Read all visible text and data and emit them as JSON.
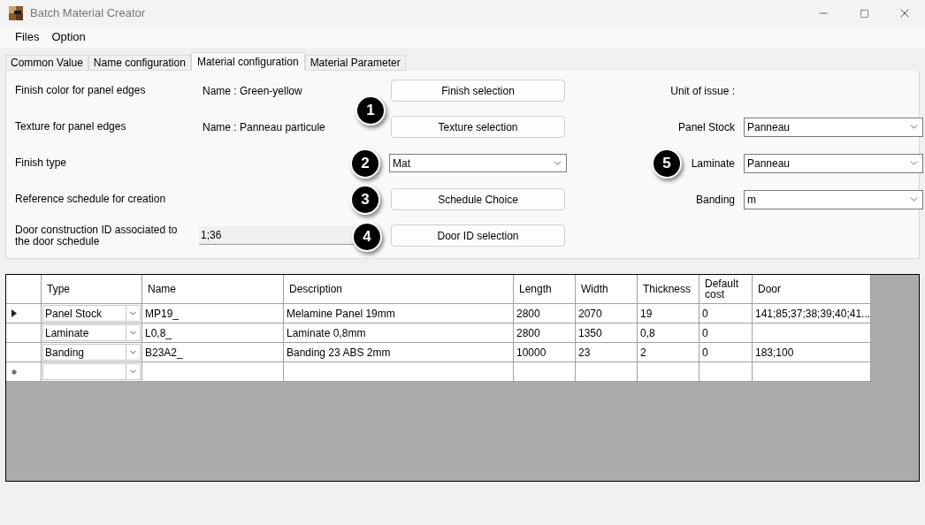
{
  "window": {
    "title": "Batch Material Creator"
  },
  "menu": [
    "Files",
    "Option"
  ],
  "tabs": [
    {
      "label": "Common Value",
      "selected": false
    },
    {
      "label": "Name configuration",
      "selected": false
    },
    {
      "label": "Material configuration",
      "selected": true
    },
    {
      "label": "Material Parameter",
      "selected": false
    }
  ],
  "form_rows": [
    {
      "label": "Finish color for panel edges",
      "info": {
        "kind": "text",
        "value": "Name : Green-yellow"
      },
      "control": {
        "kind": "button",
        "label": "Finish selection"
      }
    },
    {
      "label": "Texture for panel edges",
      "info": {
        "kind": "text",
        "value": "Name : Panneau particule"
      },
      "control": {
        "kind": "button",
        "label": "Texture selection"
      }
    },
    {
      "label": "Finish type",
      "control": {
        "kind": "combo",
        "value": "Mat"
      }
    },
    {
      "label": "Reference schedule for creation",
      "control": {
        "kind": "button",
        "label": "Schedule Choice"
      }
    },
    {
      "label": "Door construction ID associated to the door schedule",
      "info": {
        "kind": "field",
        "value": "1;36"
      },
      "control": {
        "kind": "button",
        "label": "Door ID selection"
      }
    }
  ],
  "unit_rows": [
    {
      "kind": "heading",
      "label": "Unit of issue :"
    },
    {
      "kind": "combo",
      "label": "Panel Stock",
      "value": "Panneau"
    },
    {
      "kind": "combo",
      "label": "Laminate",
      "value": "Panneau"
    },
    {
      "kind": "combo",
      "label": "Banding",
      "value": "m"
    }
  ],
  "callouts": [
    "1",
    "2",
    "3",
    "4",
    "5"
  ],
  "table": {
    "columns": [
      "Type",
      "Name",
      "Description",
      "Length",
      "Width",
      "Thickness",
      "Default cost",
      "Door"
    ],
    "rows": [
      {
        "kind": "data",
        "selected": true,
        "cells": [
          "Panel Stock",
          "MP19_",
          "Melamine Panel 19mm",
          "2800",
          "2070",
          "19",
          "0",
          "141;85;37;38;39;40;41..."
        ]
      },
      {
        "kind": "data",
        "selected": false,
        "cells": [
          "Laminate",
          "L0,8_",
          "Laminate 0,8mm",
          "2800",
          "1350",
          "0,8",
          "0"
        ]
      },
      {
        "kind": "data",
        "selected": false,
        "cells": [
          "Banding",
          "B23A2_",
          "Banding 23 ABS 2mm",
          "10000",
          "23",
          "2",
          "0",
          "183;100"
        ]
      },
      {
        "kind": "new"
      }
    ]
  }
}
